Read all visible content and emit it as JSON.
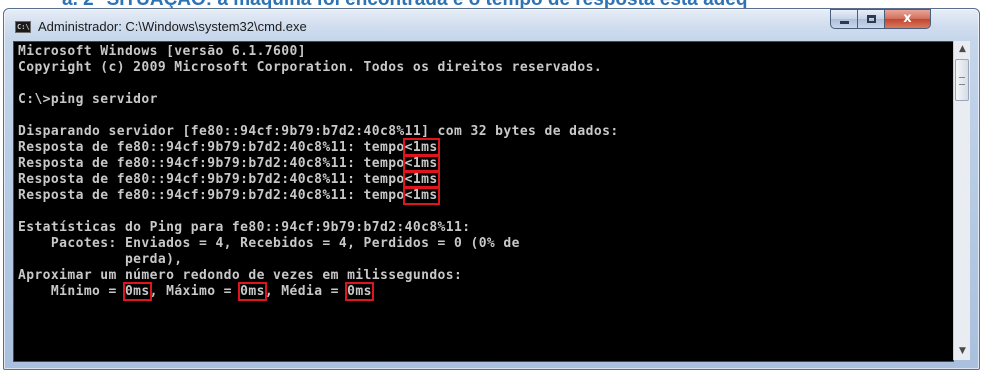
{
  "document": {
    "partial_heading": "a.  2° SITUAÇÃO: a máquina foi encontrada e o tempo de resposta está adeq"
  },
  "window": {
    "title": "Administrador: C:\\Windows\\system32\\cmd.exe",
    "icon_text": "C:\\",
    "controls": {
      "minimize": "minimize",
      "maximize": "maximize",
      "close": "x"
    }
  },
  "console": {
    "lines": [
      "Microsoft Windows [versão 6.1.7600]",
      "Copyright (c) 2009 Microsoft Corporation. Todos os direitos reservados.",
      "",
      "C:\\>ping servidor",
      "",
      "Disparando servidor [fe80::94cf:9b79:b7d2:40c8%11] com 32 bytes de dados:",
      "Resposta de fe80::94cf:9b79:b7d2:40c8%11: tempo<1ms",
      "Resposta de fe80::94cf:9b79:b7d2:40c8%11: tempo<1ms",
      "Resposta de fe80::94cf:9b79:b7d2:40c8%11: tempo<1ms",
      "Resposta de fe80::94cf:9b79:b7d2:40c8%11: tempo<1ms",
      "",
      "Estatísticas do Ping para fe80::94cf:9b79:b7d2:40c8%11:",
      "    Pacotes: Enviados = 4, Recebidos = 4, Perdidos = 0 (0% de",
      "             perda),",
      "Aproximar um número redondo de vezes em milissegundos:",
      "    Mínimo = 0ms, Máximo = 0ms, Média = 0ms"
    ],
    "highlights": [
      "<1ms",
      "0ms"
    ]
  },
  "colors": {
    "highlight_box": "#e0141b",
    "console_text": "#c8c8c8",
    "console_bg": "#000000",
    "close_button": "#c0462f",
    "doc_heading": "#2e74b5"
  }
}
